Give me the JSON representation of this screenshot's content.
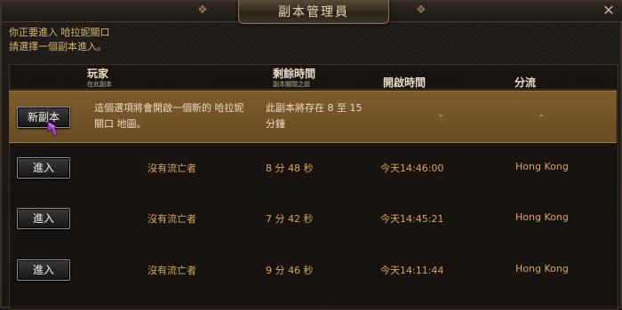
{
  "window": {
    "title": "副本管理員",
    "close": "✕"
  },
  "intro": {
    "line1": "你正要進入 哈拉妮關口",
    "line2": "請選擇一個副本進入。"
  },
  "columns": {
    "player": {
      "label": "玩家",
      "sub": "在此副本"
    },
    "remaining": {
      "label": "剩餘時間",
      "sub": "副本關閉之前"
    },
    "opened": {
      "label": "開啟時間"
    },
    "server": {
      "label": "分流"
    }
  },
  "new_instance": {
    "button": "新副本",
    "desc_line1": "這個選項將會開啟一個新的 哈拉妮",
    "desc_line2": "關口 地圖。",
    "remaining_line1": "此副本將存在 8 至 15",
    "remaining_line2": "分鐘",
    "opened": "-",
    "server": "-"
  },
  "instances": [
    {
      "button": "進入",
      "player": "沒有流亡者",
      "remaining": "8 分 48 秒",
      "opened": "今天14:46:00",
      "server": "Hong Kong"
    },
    {
      "button": "進入",
      "player": "沒有流亡者",
      "remaining": "7 分 42 秒",
      "opened": "今天14:45:21",
      "server": "Hong Kong"
    },
    {
      "button": "進入",
      "player": "沒有流亡者",
      "remaining": "9 分 46 秒",
      "opened": "今天14:11:44",
      "server": "Hong Kong"
    }
  ],
  "icons": {
    "cursor": "hand-pointer-cursor-icon",
    "close": "close-icon"
  },
  "colors": {
    "highlight": "#7d5c2c",
    "text_gold": "#d9a560",
    "intro_gold": "#d9b66a"
  }
}
